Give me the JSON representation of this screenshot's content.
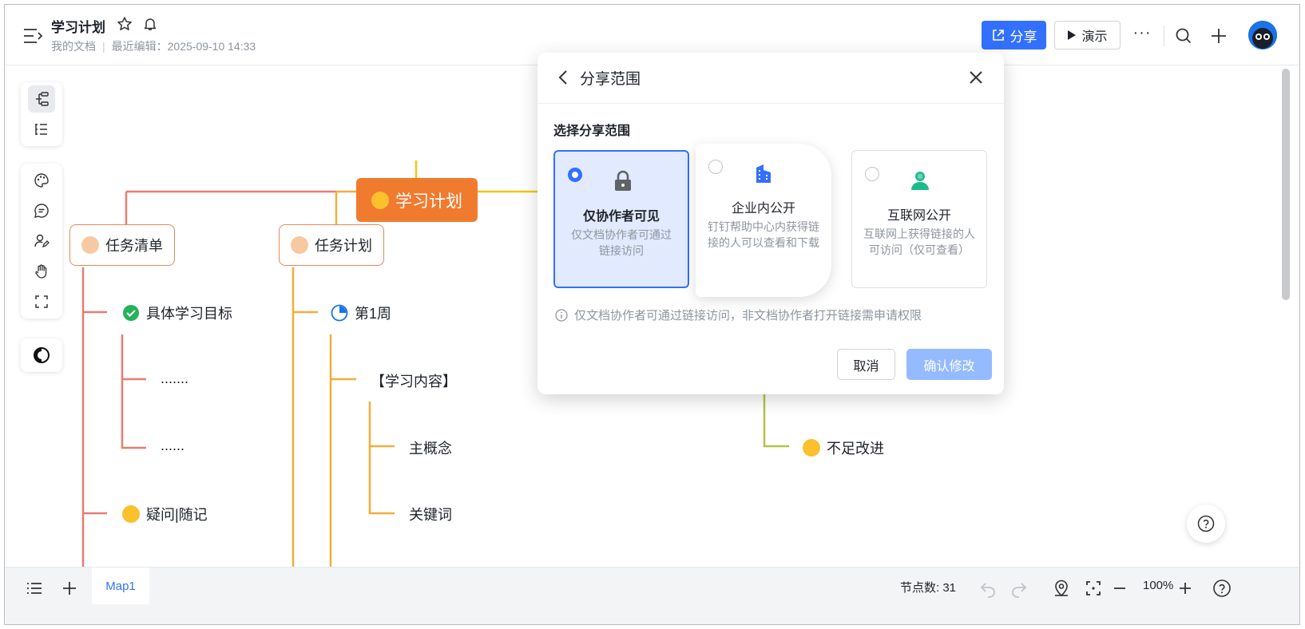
{
  "header": {
    "doc_title": "学习计划",
    "location": "我的文档",
    "last_edited": "最近编辑：2025-09-10 14:33",
    "share_label": "分享",
    "present_label": "演示",
    "more_label": "···"
  },
  "mindmap": {
    "root": "学习计划",
    "task_list": "任务清单",
    "task_plan": "任务计划",
    "goals": "具体学习目标",
    "placeholder1": ".......",
    "placeholder2": "......",
    "notes": "疑问|随记",
    "week1": "第1周",
    "content": "【学习内容】",
    "main_concept": "主概念",
    "keywords": "关键词",
    "improve": "不足改进"
  },
  "dialog": {
    "title": "分享范围",
    "subtitle": "选择分享范围",
    "options": [
      {
        "title": "仅协作者可见",
        "desc": "仅文档协作者可通过链接访问",
        "icon": "lock-icon"
      },
      {
        "title": "企业内公开",
        "desc": "钉钉帮助中心内获得链接的人可以查看和下载",
        "icon": "building-icon"
      },
      {
        "title": "互联网公开",
        "desc": "互联网上获得链接的人可访问（仅可查看）",
        "icon": "people-icon"
      }
    ],
    "hint": "仅文档协作者可通过链接访问，非文档协作者打开链接需申请权限",
    "cancel_label": "取消",
    "confirm_label": "确认修改"
  },
  "bottom": {
    "tab_label": "Map1",
    "node_count": "节点数: 31",
    "zoom": "100%"
  },
  "colors": {
    "accent": "#3370ff",
    "root_node": "#f07b2e",
    "branch_red": "#e77c73",
    "branch_orange": "#f2ae3a",
    "branch_yellow": "#f5c518",
    "branch_green": "#b3c24a"
  }
}
